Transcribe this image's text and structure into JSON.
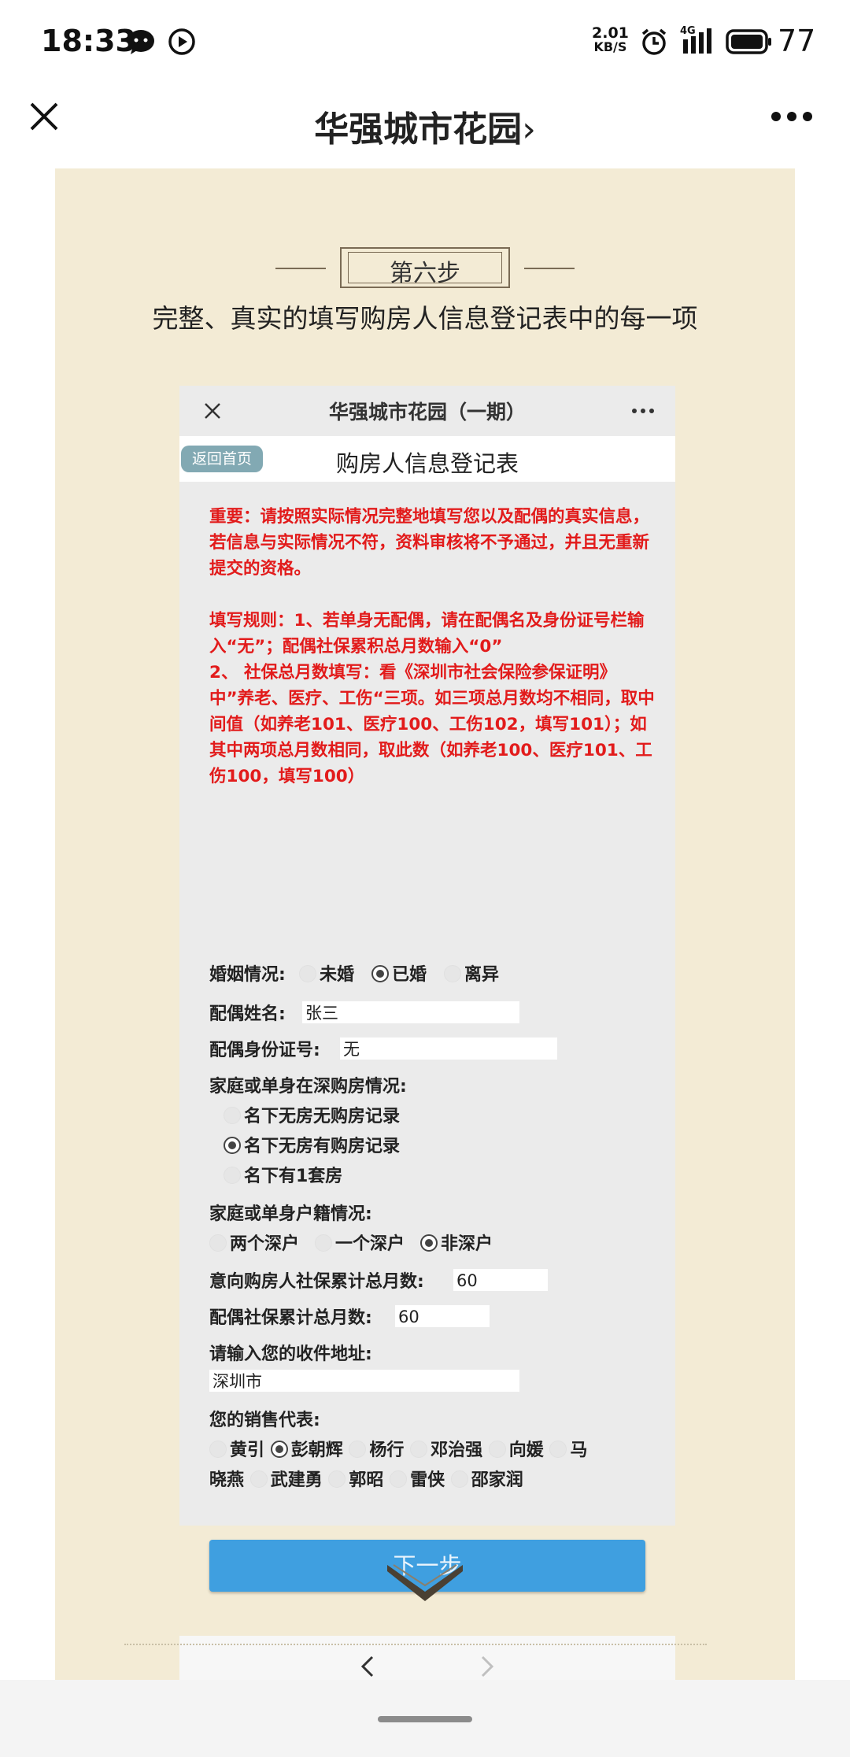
{
  "status_bar": {
    "time": "18:33",
    "net_speed_value": "2.01",
    "net_speed_unit": "KB/S",
    "signal_type": "4G",
    "battery": "77"
  },
  "nav": {
    "title": "华强城市花园",
    "title_chevron": "›"
  },
  "step": {
    "label": "第六步",
    "description": "完整、真实的填写购房人信息登记表中的每一项"
  },
  "inner": {
    "title": "华强城市花园（一期）",
    "back_button": "返回首页",
    "form_title": "购房人信息登记表",
    "notice": [
      "重要：请按照实际情况完整地填写您以及配偶的真实信息，若信息与实际情况不符，资料审核将不予通过，并且无重新提交的资格。",
      "",
      "填写规则：1、若单身无配偶，请在配偶名及身份证号栏输入“无”；配偶社保累积总月数输入“0”",
      "2、 社保总月数填写：看《深圳市社会保险参保证明》中”养老、医疗、工伤“三项。如三项总月数均不相同，取中间值（如养老101、医疗100、工伤102，填写101）；如其中两项总月数相同，取此数（如养老100、医疗101、工伤100，填写100）"
    ],
    "marital": {
      "label": "婚姻情况:",
      "options": [
        "未婚",
        "已婚",
        "离异"
      ],
      "selected": 1
    },
    "spouse_name": {
      "label": "配偶姓名:",
      "value": "张三"
    },
    "spouse_id": {
      "label": "配偶身份证号:",
      "value": "无"
    },
    "housing": {
      "label": "家庭或单身在深购房情况:",
      "options": [
        "名下无房无购房记录",
        "名下无房有购房记录",
        "名下有1套房"
      ],
      "selected": 1
    },
    "hukou": {
      "label": "家庭或单身户籍情况:",
      "options": [
        "两个深户",
        "一个深户",
        "非深户"
      ],
      "selected": 2
    },
    "buyer_months": {
      "label": "意向购房人社保累计总月数:",
      "value": "60"
    },
    "spouse_months": {
      "label": "配偶社保累计总月数:",
      "value": "60"
    },
    "address": {
      "label": "请输入您的收件地址:",
      "value": "深圳市"
    },
    "sales": {
      "label": "您的销售代表:",
      "row1": [
        "黄引",
        "彭朝辉",
        "杨行",
        "邓治强",
        "向媛",
        "马"
      ],
      "row2_prefix": "晓燕",
      "row2": [
        "武建勇",
        "郭昭",
        "雷侠",
        "邵家润"
      ],
      "selected": "彭朝辉"
    },
    "next_button": "下一步"
  },
  "colors": {
    "page_bg": "#f3ebd5",
    "notice_red": "#e21b1b",
    "button_blue": "#3f9fe0",
    "back_btn": "#82a9b3"
  }
}
